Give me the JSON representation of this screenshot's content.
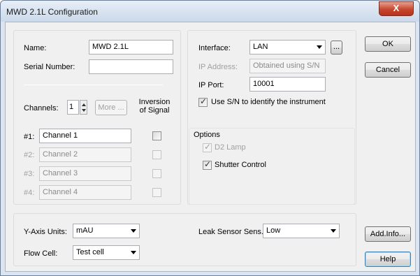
{
  "window": {
    "title": "MWD 2.1L Configuration",
    "close_glyph": "X"
  },
  "instrument": {
    "name_label": "Name:",
    "name_value": "MWD 2.1L",
    "serial_label": "Serial Number:",
    "serial_value": ""
  },
  "channels": {
    "label": "Channels:",
    "count": "1",
    "more_label": "More ...",
    "inversion_line1": "Inversion",
    "inversion_line2": "of Signal",
    "rows": [
      {
        "id": "#1:",
        "value": "Channel 1",
        "enabled": true,
        "inverted": false
      },
      {
        "id": "#2:",
        "value": "Channel 2",
        "enabled": false,
        "inverted": false
      },
      {
        "id": "#3:",
        "value": "Channel 3",
        "enabled": false,
        "inverted": false
      },
      {
        "id": "#4:",
        "value": "Channel 4",
        "enabled": false,
        "inverted": false
      }
    ]
  },
  "connection": {
    "interface_label": "Interface:",
    "interface_value": "LAN",
    "browse_label": "...",
    "ip_address_label": "IP Address:",
    "ip_address_value": "Obtained using S/N",
    "ip_port_label": "IP Port:",
    "ip_port_value": "10001",
    "use_sn_label": "Use S/N to identify the instrument",
    "use_sn_checked": true
  },
  "options": {
    "group_label": "Options",
    "d2_lamp_label": "D2 Lamp",
    "d2_lamp_checked": true,
    "shutter_label": "Shutter Control",
    "shutter_checked": true
  },
  "bottom": {
    "y_axis_label": "Y-Axis Units:",
    "y_axis_value": "mAU",
    "flow_cell_label": "Flow Cell:",
    "flow_cell_value": "Test cell",
    "leak_label": "Leak Sensor Sens.:",
    "leak_value": "Low"
  },
  "buttons": {
    "ok": "OK",
    "cancel": "Cancel",
    "add_info": "Add.Info...",
    "help": "Help"
  },
  "check_glyph": "✓"
}
